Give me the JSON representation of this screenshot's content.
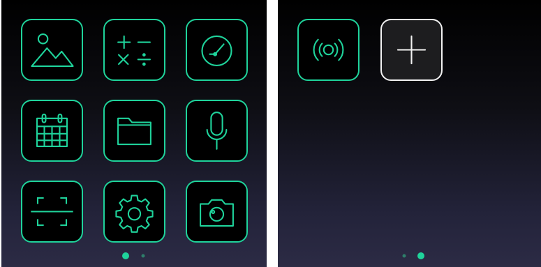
{
  "colors": {
    "accent": "#1fd39b",
    "tile_background": "#000000",
    "add_tile_background": "#1d1d1f",
    "add_tile_border": "#f2f2f2",
    "inactive_dot": "#2e7e6a"
  },
  "screens": [
    {
      "apps": [
        {
          "icon": "gallery-icon"
        },
        {
          "icon": "calculator-icon"
        },
        {
          "icon": "gauge-icon"
        },
        {
          "icon": "calendar-icon"
        },
        {
          "icon": "folder-icon"
        },
        {
          "icon": "microphone-icon"
        },
        {
          "icon": "scanner-icon"
        },
        {
          "icon": "settings-icon"
        },
        {
          "icon": "camera-icon"
        }
      ],
      "page_indicator": {
        "total": 2,
        "active_index": 0
      }
    },
    {
      "apps": [
        {
          "icon": "broadcast-icon"
        },
        {
          "icon": "add-icon"
        }
      ],
      "page_indicator": {
        "total": 2,
        "active_index": 1
      }
    }
  ]
}
